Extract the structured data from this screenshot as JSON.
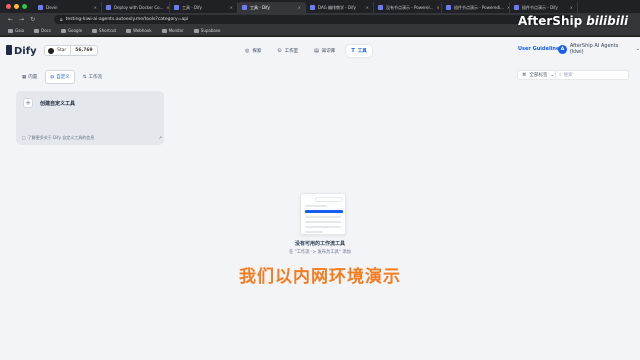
{
  "browser": {
    "tabs": [
      {
        "title": "Devin",
        "active": false
      },
      {
        "title": "Deploy with Docker Co...",
        "active": false
      },
      {
        "title": "工具 - Dify",
        "active": false
      },
      {
        "title": "工具 - Dify",
        "active": true
      },
      {
        "title": "DAG 编排教学 - Dify",
        "active": false
      },
      {
        "title": "没有节点演示 - Powerel...",
        "active": false
      },
      {
        "title": "插件节点演示 - Poweredi...",
        "active": false
      },
      {
        "title": "插件节点演示 - Dify",
        "active": false
      }
    ],
    "url": "testing-kiwi-ai-agents.autoexly.me/tools?category=api",
    "bookmarks": [
      "Gaia",
      "Docs",
      "Google",
      "Shortcut",
      "Webhook",
      "Monitor",
      "Supabase"
    ]
  },
  "app": {
    "logo": "Dify",
    "github_star_label": "Star",
    "github_star_count": "56,769",
    "nav": [
      {
        "label": "探索",
        "icon": "compass-icon",
        "active": false
      },
      {
        "label": "工作室",
        "icon": "studio-icon",
        "active": false
      },
      {
        "label": "知识库",
        "icon": "book-icon",
        "active": false
      },
      {
        "label": "工具",
        "icon": "tool-icon",
        "active": true
      }
    ],
    "user_guideline": "User Guideline",
    "account_initial": "A",
    "account_name": "AfterShip AI Agents (kiwi)",
    "account_caret": "⌄"
  },
  "tools_page": {
    "subtabs": [
      {
        "label": "内置",
        "active": false
      },
      {
        "label": "自定义",
        "active": true
      },
      {
        "label": "工作流",
        "active": false
      }
    ],
    "tag_filter": "全部标签",
    "search_placeholder": "搜索",
    "create_card": {
      "title": "创建自定义工具",
      "footer": "了解更多关于 Dify 自定义工具的信息",
      "arrow": "↗"
    },
    "empty_title": "没有可用的工作流工具",
    "empty_sub": "在 \"工作流 -> 发布为工具\" 添加"
  },
  "overlay": {
    "subtitle": "我们以内网环境演示",
    "watermark_brand": "AfterShip",
    "watermark_bili": "bilibili"
  }
}
